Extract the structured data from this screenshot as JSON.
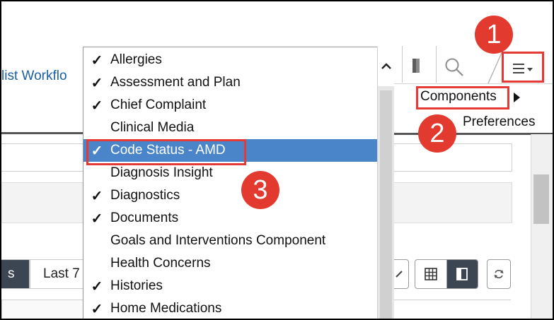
{
  "background": {
    "workflow_link": "list Workflo",
    "preferences_label": "Preferences",
    "tab_partial_left": "s",
    "tab_last": "Last 7"
  },
  "toolbar": {
    "components_label": "Components"
  },
  "callouts": [
    "1",
    "2",
    "3"
  ],
  "menu": {
    "check_glyph": "✓",
    "items": [
      {
        "label": "Allergies",
        "checked": true
      },
      {
        "label": "Assessment and Plan",
        "checked": true
      },
      {
        "label": "Chief Complaint",
        "checked": true
      },
      {
        "label": "Clinical Media",
        "checked": false
      },
      {
        "label": "Code Status - AMD",
        "checked": true,
        "selected": true
      },
      {
        "label": "Diagnosis Insight",
        "checked": false
      },
      {
        "label": "Diagnostics",
        "checked": true
      },
      {
        "label": "Documents",
        "checked": true
      },
      {
        "label": "Goals and Interventions Component",
        "checked": false
      },
      {
        "label": "Health Concerns",
        "checked": false
      },
      {
        "label": "Histories",
        "checked": true
      },
      {
        "label": "Home Medications",
        "checked": true
      }
    ]
  },
  "colors": {
    "accent_selected": "#4a84c9",
    "callout_red": "#e53935",
    "link_blue": "#1b5fa8"
  },
  "icons": [
    "chevron-up-icon",
    "bookmark-icon",
    "search-icon",
    "hamburger-menu-icon",
    "caret-right-icon",
    "grid-view-icon",
    "panel-view-icon",
    "refresh-icon"
  ]
}
